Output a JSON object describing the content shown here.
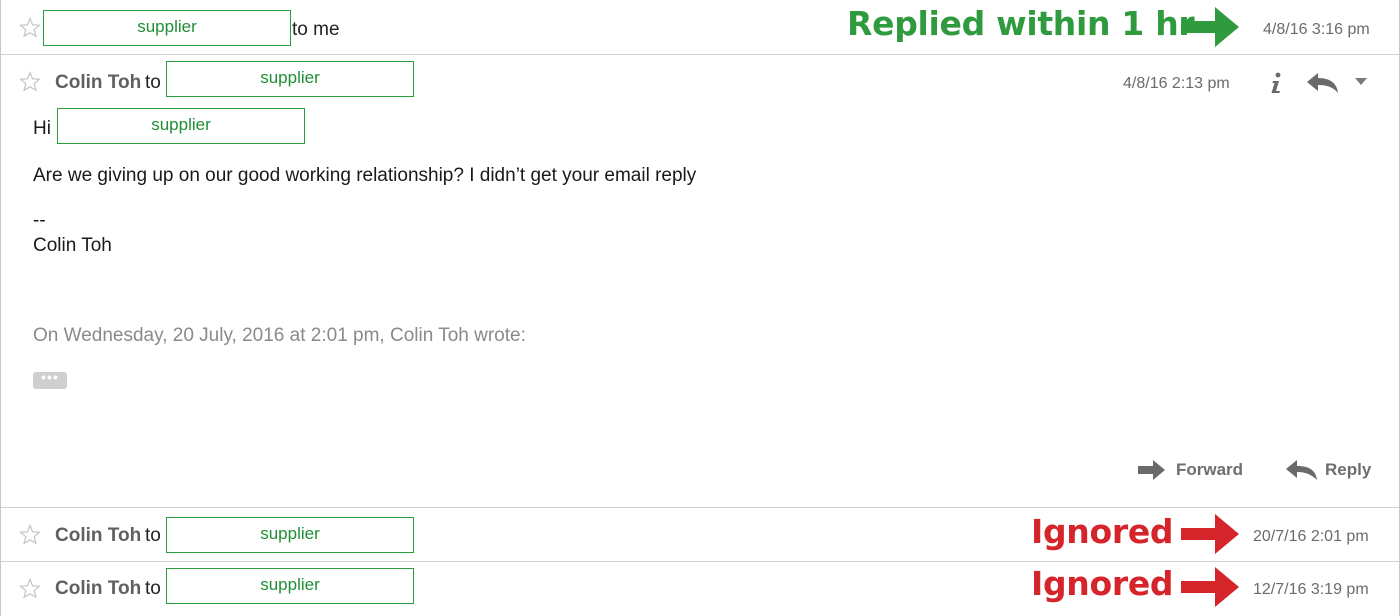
{
  "messages": [
    {
      "sender": "",
      "recipient": "supplier",
      "to_text": "to me",
      "date": "4/8/16 3:16 pm",
      "annotation": "Replied within 1 hr",
      "annotation_color": "#2f9a3e"
    },
    {
      "sender": "Colin Toh",
      "to_word": "to",
      "recipient": "supplier",
      "date": "4/8/16 2:13 pm",
      "greeting": "Hi",
      "greeting_recipient": "supplier",
      "body_line": "Are we giving up on our good working relationship? I didn’t get your email reply",
      "signature_dashes": "--",
      "signature_name": "Colin Toh",
      "quote_header": "On Wednesday, 20 July, 2016 at 2:01 pm, Colin Toh wrote:",
      "quote_toggle": "•••",
      "actions": {
        "forward": "Forward",
        "reply": "Reply"
      },
      "icons": [
        "info-icon",
        "reply-icon",
        "more-dropdown-icon"
      ]
    },
    {
      "sender": "Colin Toh",
      "to_word": "to",
      "recipient": "supplier",
      "date": "20/7/16 2:01 pm",
      "annotation": "Ignored",
      "annotation_color": "#d6242b"
    },
    {
      "sender": "Colin Toh",
      "to_word": "to",
      "recipient": "supplier",
      "date": "12/7/16 3:19 pm",
      "annotation": "Ignored",
      "annotation_color": "#d6242b"
    }
  ],
  "colors": {
    "redaction_border": "#2a9d3c",
    "reply_annotation": "#2f9a3e",
    "ignored_annotation": "#d6242b",
    "meta_gray": "#6b6b6b"
  }
}
